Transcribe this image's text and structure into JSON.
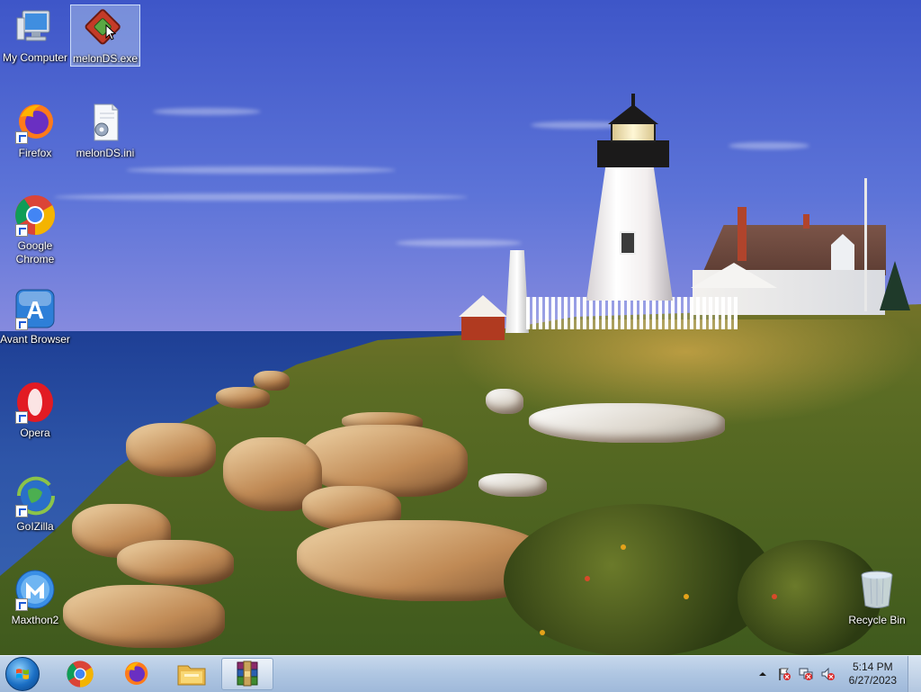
{
  "desktop": {
    "icons": [
      {
        "label": "My Computer"
      },
      {
        "label": "melonDS.exe"
      },
      {
        "label": "Firefox"
      },
      {
        "label": "melonDS.ini"
      },
      {
        "label": "Google Chrome"
      },
      {
        "label": "Avant Browser"
      },
      {
        "label": "Opera"
      },
      {
        "label": "GoIZilla"
      },
      {
        "label": "Maxthon2"
      },
      {
        "label": "Recycle Bin"
      }
    ]
  },
  "taskbar": {
    "pinned": [
      {
        "icon": "chrome-icon"
      },
      {
        "icon": "firefox-icon"
      },
      {
        "icon": "file-explorer-icon"
      },
      {
        "icon": "winrar-icon",
        "active": true
      }
    ],
    "clock": {
      "time": "5:14 PM",
      "date": "6/27/2023"
    }
  },
  "colors": {
    "taskbar_top": "#c7d8ec",
    "taskbar_bottom": "#9fb9da",
    "selection": "#bed2f0"
  }
}
